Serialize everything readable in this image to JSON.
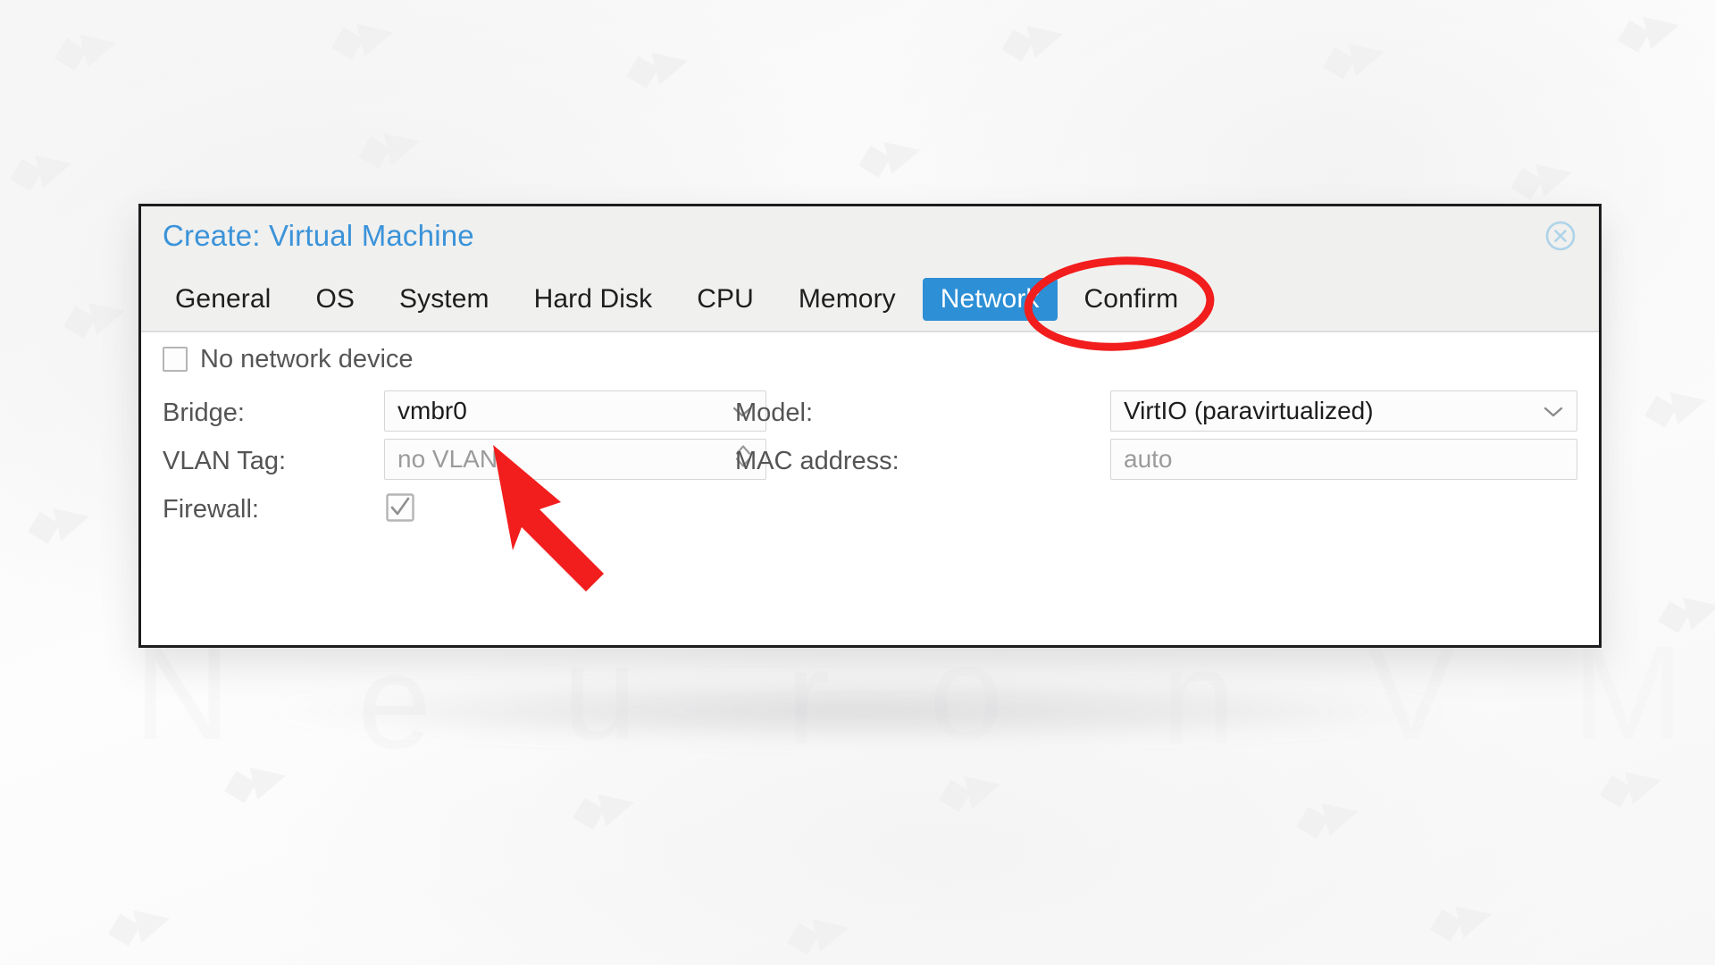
{
  "dialog": {
    "title": "Create: Virtual Machine",
    "close_icon": "close-circle-icon"
  },
  "tabs": [
    {
      "label": "General",
      "active": false
    },
    {
      "label": "OS",
      "active": false
    },
    {
      "label": "System",
      "active": false
    },
    {
      "label": "Hard Disk",
      "active": false
    },
    {
      "label": "CPU",
      "active": false
    },
    {
      "label": "Memory",
      "active": false
    },
    {
      "label": "Network",
      "active": true
    },
    {
      "label": "Confirm",
      "active": false
    }
  ],
  "form": {
    "no_network_device": {
      "label": "No network device",
      "checked": false
    },
    "bridge": {
      "label": "Bridge:",
      "value": "vmbr0",
      "icon": "chevron-down-icon"
    },
    "vlan_tag": {
      "label": "VLAN Tag:",
      "placeholder": "no VLAN",
      "value": "",
      "icon": "spinner-updown-icon"
    },
    "firewall": {
      "label": "Firewall:",
      "checked": true
    },
    "model": {
      "label": "Model:",
      "value": "VirtIO (paravirtualized)",
      "icon": "chevron-down-icon"
    },
    "mac_address": {
      "label": "MAC address:",
      "placeholder": "auto",
      "value": ""
    }
  },
  "annotations": {
    "highlight_ellipse_target": "Network",
    "arrow_target": "vmbr0",
    "color": "#f21d1d"
  },
  "colors": {
    "accent_blue": "#2d8fd5",
    "title_blue": "#3b93d9",
    "annotation_red": "#f21d1d",
    "header_bg": "#f0f0ef",
    "dialog_border": "#1d1d1f"
  },
  "watermark": {
    "letters": [
      "N",
      "e",
      "u",
      "r",
      "o",
      "n",
      "V",
      "M"
    ]
  }
}
